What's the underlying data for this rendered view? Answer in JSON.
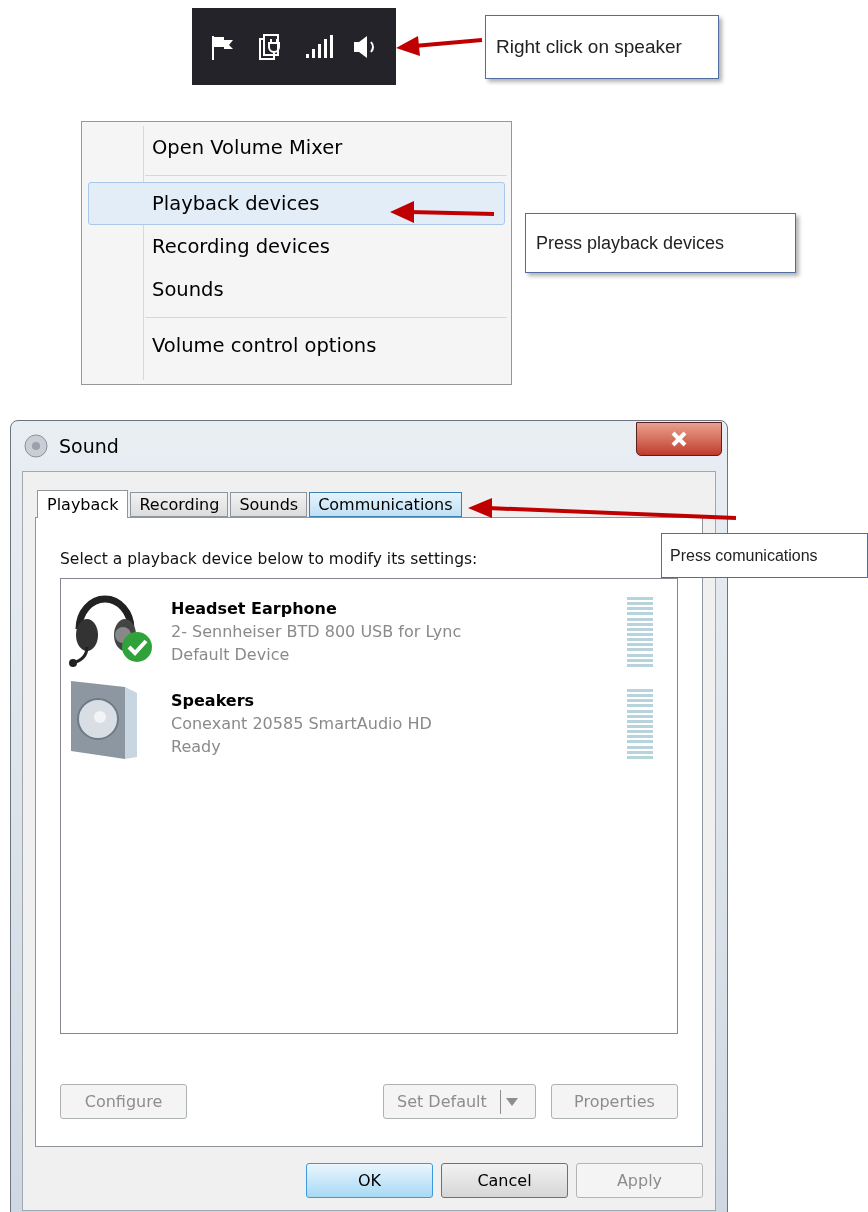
{
  "tray_step": {
    "callout": "Right click on speaker"
  },
  "menu_step": {
    "groups": [
      [
        {
          "label": "Open Volume Mixer",
          "selected": false
        }
      ],
      [
        {
          "label": "Playback devices",
          "selected": true
        },
        {
          "label": "Recording devices",
          "selected": false
        },
        {
          "label": "Sounds",
          "selected": false
        }
      ],
      [
        {
          "label": "Volume control options",
          "selected": false
        }
      ]
    ],
    "callout": "Press playback devices"
  },
  "sound_window": {
    "title": "Sound",
    "tabs": [
      {
        "label": "Playback",
        "selected": true,
        "highlighted": false
      },
      {
        "label": "Recording",
        "selected": false,
        "highlighted": false
      },
      {
        "label": "Sounds",
        "selected": false,
        "highlighted": false
      },
      {
        "label": "Communications",
        "selected": false,
        "highlighted": true
      }
    ],
    "instruction": "Select a playback device below to modify its settings:",
    "devices": [
      {
        "kind": "headset",
        "name": "Headset Earphone",
        "description": "2- Sennheiser BTD 800 USB for Lync",
        "status": "Default Device",
        "default": true
      },
      {
        "kind": "speaker",
        "name": "Speakers",
        "description": "Conexant 20585 SmartAudio HD",
        "status": "Ready",
        "default": false
      }
    ],
    "panel_buttons": [
      {
        "kind": "plain",
        "label": "Configure",
        "disabled": true
      },
      {
        "kind": "split",
        "label": "Set Default",
        "disabled": true
      },
      {
        "kind": "plain",
        "label": "Properties",
        "disabled": true
      }
    ],
    "dialog_buttons": [
      {
        "label": "OK",
        "disabled": false,
        "default": true
      },
      {
        "label": "Cancel",
        "disabled": false,
        "default": false
      },
      {
        "label": "Apply",
        "disabled": true,
        "default": false
      }
    ],
    "callout": "Press comunications"
  }
}
